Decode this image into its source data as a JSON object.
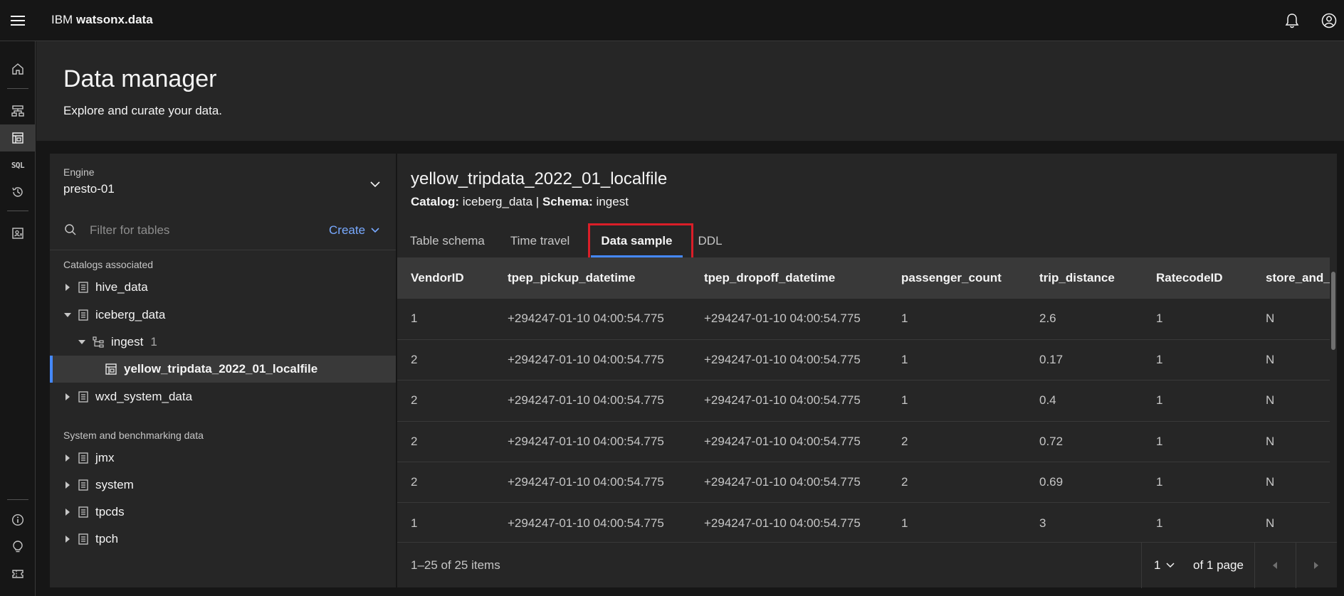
{
  "app": {
    "brand_prefix": "IBM",
    "brand_name": "watsonx.data"
  },
  "rail": {
    "sql_label": "SQL"
  },
  "page": {
    "title": "Data manager",
    "subtitle": "Explore and curate your data."
  },
  "engine": {
    "label": "Engine",
    "value": "presto-01"
  },
  "search": {
    "placeholder": "Filter for tables",
    "create_label": "Create"
  },
  "tree": {
    "catalogs_heading": "Catalogs associated",
    "catalogs": [
      {
        "label": "hive_data"
      },
      {
        "label": "iceberg_data"
      },
      {
        "label": "ingest",
        "count": "1"
      },
      {
        "label": "yellow_tripdata_2022_01_localfile"
      },
      {
        "label": "wxd_system_data"
      }
    ],
    "system_heading": "System and benchmarking data",
    "system": [
      {
        "label": "jmx"
      },
      {
        "label": "system"
      },
      {
        "label": "tpcds"
      },
      {
        "label": "tpch"
      }
    ]
  },
  "table": {
    "title": "yellow_tripdata_2022_01_localfile",
    "catalog_label": "Catalog:",
    "catalog_value": "iceberg_data",
    "schema_label": "Schema:",
    "schema_value": "ingest",
    "meta_sep": "|"
  },
  "tabs": [
    "Table schema",
    "Time travel",
    "Data sample",
    "DDL"
  ],
  "active_tab": "Data sample",
  "grid": {
    "columns": [
      "VendorID",
      "tpep_pickup_datetime",
      "tpep_dropoff_datetime",
      "passenger_count",
      "trip_distance",
      "RatecodeID",
      "store_and_fwd_flag"
    ],
    "rows": [
      [
        "1",
        "+294247-01-10 04:00:54.775",
        "+294247-01-10 04:00:54.775",
        "1",
        "2.6",
        "1",
        "N"
      ],
      [
        "2",
        "+294247-01-10 04:00:54.775",
        "+294247-01-10 04:00:54.775",
        "1",
        "0.17",
        "1",
        "N"
      ],
      [
        "2",
        "+294247-01-10 04:00:54.775",
        "+294247-01-10 04:00:54.775",
        "1",
        "0.4",
        "1",
        "N"
      ],
      [
        "2",
        "+294247-01-10 04:00:54.775",
        "+294247-01-10 04:00:54.775",
        "2",
        "0.72",
        "1",
        "N"
      ],
      [
        "2",
        "+294247-01-10 04:00:54.775",
        "+294247-01-10 04:00:54.775",
        "2",
        "0.69",
        "1",
        "N"
      ],
      [
        "1",
        "+294247-01-10 04:00:54.775",
        "+294247-01-10 04:00:54.775",
        "1",
        "3",
        "1",
        "N"
      ]
    ]
  },
  "pagination": {
    "range_text": "1–25 of 25 items",
    "page_value": "1",
    "of_pages": "of 1 page"
  },
  "colors": {
    "accent": "#4589ff",
    "link": "#78a9ff",
    "highlight": "#da1e28"
  }
}
